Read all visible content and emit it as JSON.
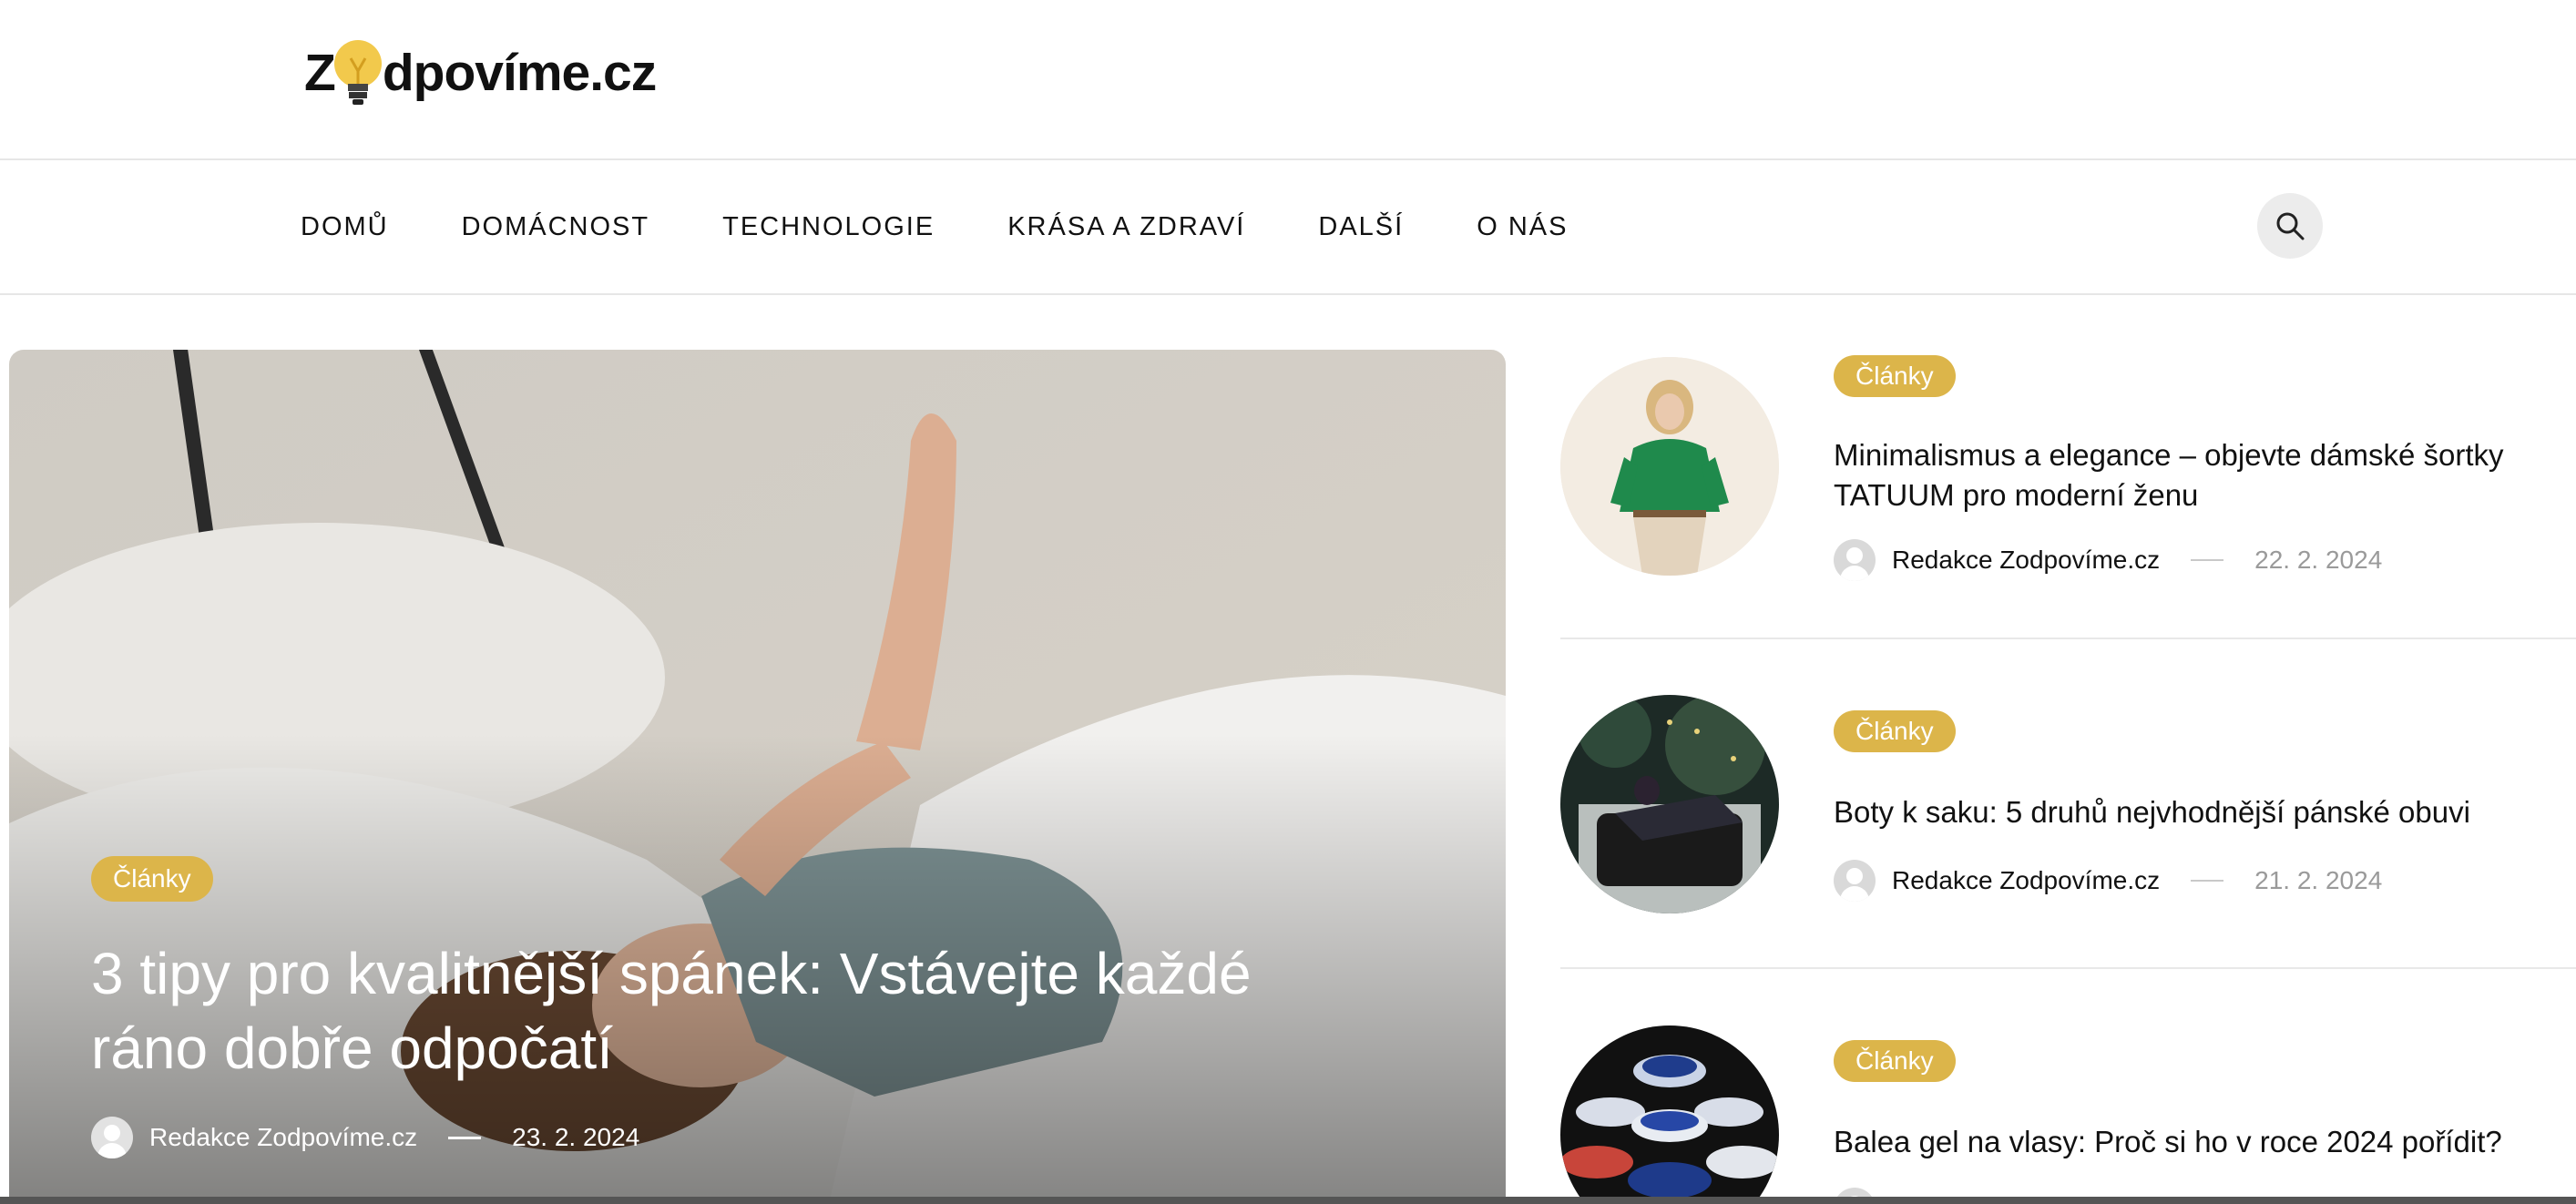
{
  "site": {
    "logo_before": "Z",
    "logo_after": "dpovíme.cz",
    "logo_full": "Zodpovíme.cz"
  },
  "nav": {
    "items": [
      "DOMŮ",
      "DOMÁCNOST",
      "TECHNOLOGIE",
      "KRÁSA A ZDRAVÍ",
      "DALŠÍ",
      "O NÁS"
    ],
    "search_icon": "search-icon"
  },
  "colors": {
    "accent": "#dcb54a",
    "text": "#111111",
    "muted": "#9a9a9a",
    "divider": "#e8e8e8"
  },
  "hero": {
    "category": "Články",
    "title": "3 tipy pro kvalitnější spánek: Vstávejte každé ráno dobře odpočatí",
    "author": "Redakce Zodpovíme.cz",
    "date": "23. 2. 2024"
  },
  "side_articles": [
    {
      "category": "Články",
      "title": "Minimalismus a elegance – objevte dámské šortky TATUUM pro moderní ženu",
      "author": "Redakce Zodpovíme.cz",
      "date": "22. 2. 2024"
    },
    {
      "category": "Články",
      "title": "Boty k saku: 5 druhů nejvhodnější pánské obuvi",
      "author": "Redakce Zodpovíme.cz",
      "date": "21. 2. 2024"
    },
    {
      "category": "Články",
      "title": "Balea gel na vlasy: Proč si ho v roce 2024 pořídit?"
    }
  ]
}
